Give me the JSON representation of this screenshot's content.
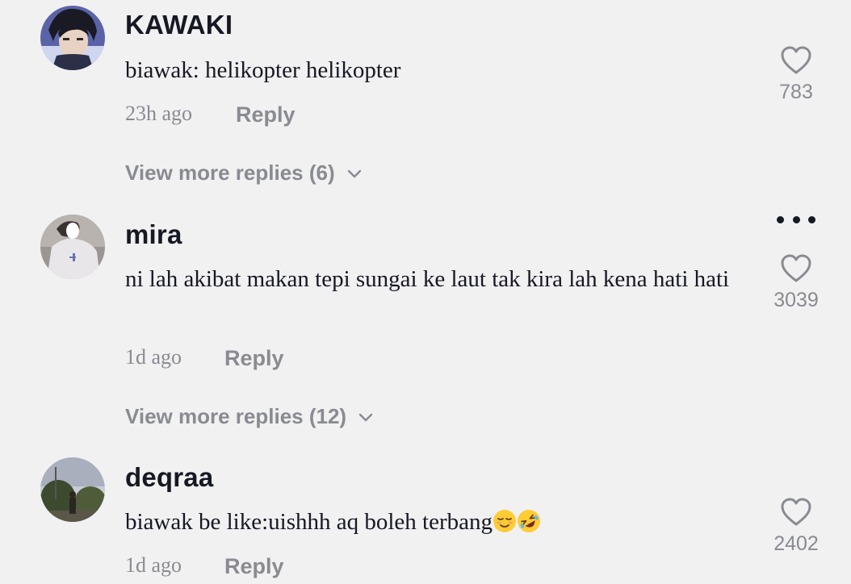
{
  "comments": [
    {
      "username": "KAWAKI",
      "text": "biawak: helikopter helikopter",
      "time": "23h ago",
      "reply_label": "Reply",
      "more_replies_label": "View more replies (6)",
      "likes": "783",
      "avatar_icon": "anime-character-avatar"
    },
    {
      "username": "mira",
      "text": "ni lah akibat makan tepi sungai ke laut tak kira lah kena hati hati",
      "time": "1d ago",
      "reply_label": "Reply",
      "more_replies_label": "View more replies (12)",
      "likes": "3039",
      "avatar_icon": "person-photo-avatar"
    },
    {
      "username": "deqraa",
      "text": "biawak be like:uishhh aq boleh terbang",
      "text_emojis": [
        "relieved-face-emoji",
        "rolling-on-floor-laughing-emoji"
      ],
      "time": "1d ago",
      "reply_label": "Reply",
      "likes": "2402",
      "avatar_icon": "outdoor-photo-avatar"
    }
  ],
  "icons": {
    "like": "heart-outline-icon",
    "more_options": "more-horizontal-icon",
    "expand": "chevron-down-icon"
  },
  "colors": {
    "background": "#f1f1f2",
    "primary_text": "#161823",
    "secondary_text": "#8a8b91"
  }
}
